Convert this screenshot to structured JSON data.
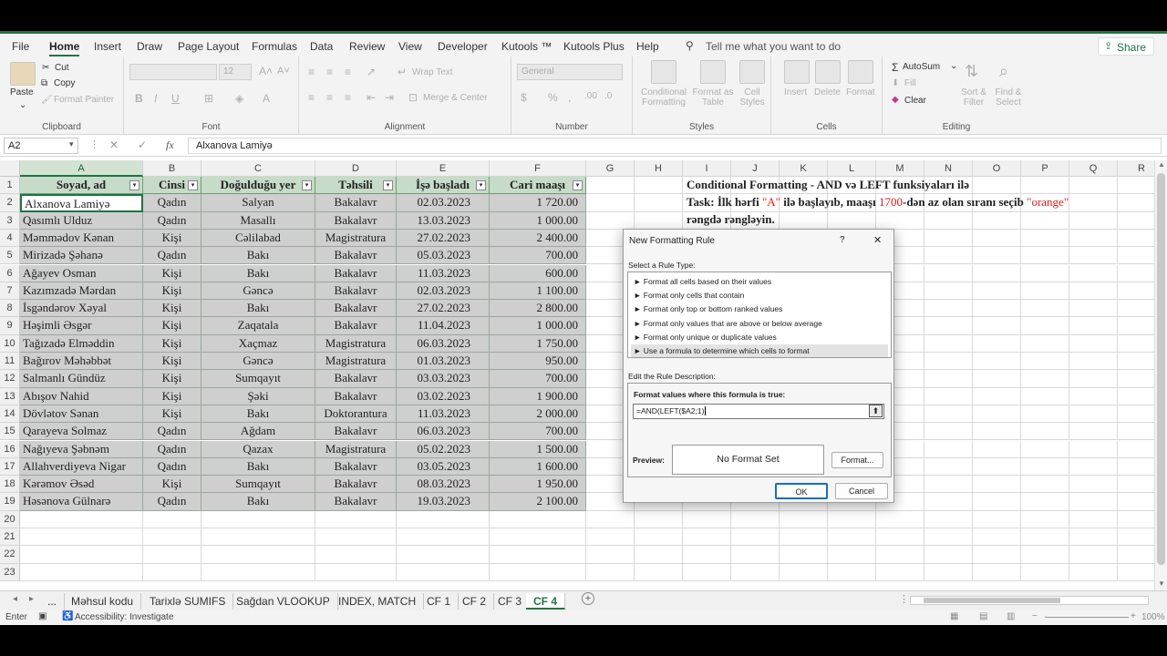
{
  "menu_tabs": [
    "File",
    "Home",
    "Insert",
    "Draw",
    "Page Layout",
    "Formulas",
    "Data",
    "Review",
    "View",
    "Developer",
    "Kutools ™",
    "Kutools Plus",
    "Help"
  ],
  "tell_me": "Tell me what you want to do",
  "share_label": "Share",
  "ribbon": {
    "paste": "Paste",
    "cut": "Cut",
    "copy": "Copy",
    "format_painter": "Format Painter",
    "clipboard": "Clipboard",
    "font": "Font",
    "font_size": "12",
    "alignment": "Alignment",
    "wrap_text": "Wrap Text",
    "merge_center": "Merge & Center",
    "number_format": "General",
    "number": "Number",
    "conditional_formatting": "Conditional\nFormatting",
    "format_as_table": "Format as\nTable",
    "cell_styles": "Cell\nStyles",
    "styles": "Styles",
    "insert": "Insert",
    "delete": "Delete",
    "format": "Format",
    "cells": "Cells",
    "autosum": "AutoSum",
    "fill": "Fill",
    "clear": "Clear",
    "sort_filter": "Sort &\nFilter",
    "find_select": "Find &\nSelect",
    "editing": "Editing"
  },
  "formula_bar": {
    "name_box": "A2",
    "content": "Alxanova Lamiyə"
  },
  "columns": [
    "A",
    "B",
    "C",
    "D",
    "E",
    "F",
    "G",
    "H",
    "I",
    "J",
    "K",
    "L",
    "M",
    "N",
    "O",
    "P",
    "Q",
    "R"
  ],
  "table": {
    "headers": [
      "Soyad, ad",
      "Cinsi",
      "Doğulduğu yer",
      "Təhsili",
      "İşə başladı",
      "Cari maaşı"
    ],
    "rows": [
      [
        "Alxanova Lamiyə",
        "Qadın",
        "Salyan",
        "Bakalavr",
        "02.03.2023",
        "1 720.00"
      ],
      [
        "Qasımlı Ulduz",
        "Qadın",
        "Masallı",
        "Bakalavr",
        "13.03.2023",
        "1 000.00"
      ],
      [
        "Məmmədov Kənan",
        "Kişi",
        "Cəlilabad",
        "Magistratura",
        "27.02.2023",
        "2 400.00"
      ],
      [
        "Mirizadə Şəhanə",
        "Qadın",
        "Bakı",
        "Bakalavr",
        "05.03.2023",
        "700.00"
      ],
      [
        "Ağayev Osman",
        "Kişi",
        "Bakı",
        "Bakalavr",
        "11.03.2023",
        "600.00"
      ],
      [
        "Kazımzadə Mərdan",
        "Kişi",
        "Gəncə",
        "Bakalavr",
        "02.03.2023",
        "1 100.00"
      ],
      [
        "İsgəndərov Xəyal",
        "Kişi",
        "Bakı",
        "Bakalavr",
        "27.02.2023",
        "2 800.00"
      ],
      [
        "Həşimli Əsgər",
        "Kişi",
        "Zaqatala",
        "Bakalavr",
        "11.04.2023",
        "1 000.00"
      ],
      [
        "Tağızadə Elməddin",
        "Kişi",
        "Xaçmaz",
        "Magistratura",
        "06.03.2023",
        "1 750.00"
      ],
      [
        "Bağırov Məhəbbət",
        "Kişi",
        "Gəncə",
        "Magistratura",
        "01.03.2023",
        "950.00"
      ],
      [
        "Salmanlı Gündüz",
        "Kişi",
        "Sumqayıt",
        "Bakalavr",
        "03.03.2023",
        "700.00"
      ],
      [
        "Abışov Nahid",
        "Kişi",
        "Şəki",
        "Bakalavr",
        "03.02.2023",
        "1 900.00"
      ],
      [
        "Dövlətov Sənan",
        "Kişi",
        "Bakı",
        "Doktorantura",
        "11.03.2023",
        "2 000.00"
      ],
      [
        "Qarayeva Solmaz",
        "Qadın",
        "Ağdam",
        "Bakalavr",
        "06.03.2023",
        "700.00"
      ],
      [
        "Nağıyeva Şəbnəm",
        "Qadın",
        "Qazax",
        "Magistratura",
        "05.02.2023",
        "1 500.00"
      ],
      [
        "Allahverdiyeva Nigar",
        "Qadın",
        "Bakı",
        "Bakalavr",
        "03.05.2023",
        "1 600.00"
      ],
      [
        "Kərəmov Əsəd",
        "Kişi",
        "Sumqayıt",
        "Bakalavr",
        "08.03.2023",
        "1 950.00"
      ],
      [
        "Həsənova Gülnarə",
        "Qadın",
        "Bakı",
        "Bakalavr",
        "19.03.2023",
        "2 100.00"
      ]
    ]
  },
  "row_numbers": [
    "1",
    "2",
    "3",
    "4",
    "5",
    "6",
    "7",
    "8",
    "9",
    "10",
    "11",
    "12",
    "13",
    "14",
    "15",
    "16",
    "17",
    "18",
    "19",
    "20",
    "21",
    "22",
    "23"
  ],
  "notes": {
    "title": "Conditional Formatting - AND və LEFT funksiyaları ilə",
    "task_prefix": "Task: İlk hərfi ",
    "task_a": "\"A\"",
    "task_mid": " ilə başlayıb, maaşı ",
    "task_1700": "1700",
    "task_after": "-dən az olan sıranı seçib ",
    "task_orange": "\"orange\"",
    "task_line2": "rəngdə rəngləyin."
  },
  "accent_colors": {
    "excel_green": "#217346",
    "note_red": "#e0201b"
  },
  "dialog": {
    "title": "New Formatting Rule",
    "help": "?",
    "close": "✕",
    "select_rule_type": "Select a Rule Type:",
    "rule_types": [
      "► Format all cells based on their values",
      "► Format only cells that contain",
      "► Format only top or bottom ranked values",
      "► Format only values that are above or below average",
      "► Format only unique or duplicate values",
      "► Use a formula to determine which cells to format"
    ],
    "edit_desc": "Edit the Rule Description:",
    "formula_label": "Format values where this formula is true:",
    "formula_value": "=AND(LEFT($A2;1)",
    "preview_label": "Preview:",
    "preview_text": "No Format Set",
    "format_button": "Format...",
    "ok": "OK",
    "cancel": "Cancel"
  },
  "sheet_tabs": [
    "...",
    "Məhsul kodu",
    "Tarixlə SUMIFS",
    "Sağdan VLOOKUP",
    "INDEX, MATCH",
    "CF 1",
    "CF 2",
    "CF 3",
    "CF 4"
  ],
  "status": {
    "mode": "Enter",
    "accessibility": "Accessibility: Investigate",
    "zoom": "100%"
  }
}
